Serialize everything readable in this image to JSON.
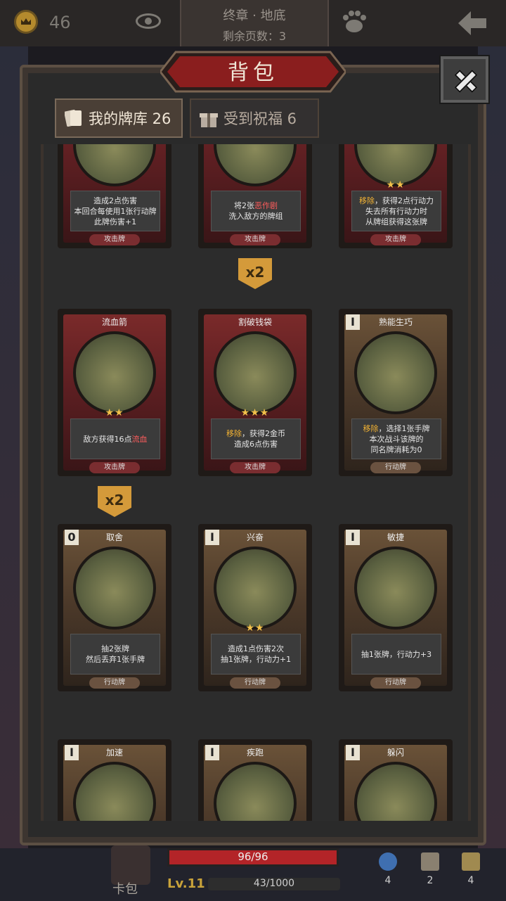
{
  "top_bar": {
    "gold": "46",
    "chapter": "终章 · 地底",
    "pages_left": "剩余页数：3",
    "icons": [
      "crown-coin-icon",
      "eye-icon",
      "paw-icon",
      "back-arrow-icon"
    ]
  },
  "panel": {
    "title": "背包",
    "tabs": [
      {
        "label": "我的牌库 26",
        "icon": "cards-icon",
        "active": true
      },
      {
        "label": "受到祝福 6",
        "icon": "gift-icon",
        "active": false
      }
    ]
  },
  "cards": [
    {
      "title": "",
      "cost": "",
      "desc_parts": [
        {
          "t": "造成2点伤害\n本回合每使用1张行动牌\n此牌伤害+1"
        }
      ],
      "stars": "",
      "type": "攻击牌",
      "kind": "attack"
    },
    {
      "title": "",
      "cost": "",
      "desc_parts": [
        {
          "t": "将2张"
        },
        {
          "t": "恶作剧",
          "c": "kw-red"
        },
        {
          "t": "\n洗入敌方的牌组"
        }
      ],
      "stars": "",
      "type": "攻击牌",
      "kind": "attack",
      "multiplier": "x2"
    },
    {
      "title": "",
      "cost": "",
      "desc_parts": [
        {
          "t": "移除",
          "c": "kw"
        },
        {
          "t": "，获得2点行动力\n失去所有行动力时\n从牌组获得这张牌"
        }
      ],
      "stars": "★★",
      "type": "攻击牌",
      "kind": "attack"
    },
    {
      "title": "流血箭",
      "cost": "",
      "desc_parts": [
        {
          "t": "敌方获得16点"
        },
        {
          "t": "流血",
          "c": "kw-red"
        }
      ],
      "stars": "★★",
      "type": "攻击牌",
      "kind": "attack",
      "multiplier": "x2"
    },
    {
      "title": "割破钱袋",
      "cost": "",
      "desc_parts": [
        {
          "t": "移除",
          "c": "kw"
        },
        {
          "t": "，获得2金币\n造成6点伤害"
        }
      ],
      "stars": "★★★",
      "type": "攻击牌",
      "kind": "attack"
    },
    {
      "title": "熟能生巧",
      "cost": "I",
      "desc_parts": [
        {
          "t": "移除",
          "c": "kw"
        },
        {
          "t": "，选择1张手牌\n本次战斗该牌的\n同名牌消耗为0"
        }
      ],
      "stars": "",
      "type": "行动牌",
      "kind": "skill"
    },
    {
      "title": "取舍",
      "cost": "0",
      "desc_parts": [
        {
          "t": "抽2张牌\n然后丢弃1张手牌"
        }
      ],
      "stars": "",
      "type": "行动牌",
      "kind": "skill"
    },
    {
      "title": "兴奋",
      "cost": "I",
      "desc_parts": [
        {
          "t": "造成1点伤害2次\n抽1张牌，行动力+1"
        }
      ],
      "stars": "★★",
      "type": "行动牌",
      "kind": "skill"
    },
    {
      "title": "敏捷",
      "cost": "I",
      "desc_parts": [
        {
          "t": "抽1张牌，行动力+3"
        }
      ],
      "stars": "",
      "type": "行动牌",
      "kind": "skill"
    },
    {
      "title": "加速",
      "cost": "I",
      "desc_parts": [],
      "stars": "",
      "type": "",
      "kind": "skill"
    },
    {
      "title": "疾跑",
      "cost": "I",
      "desc_parts": [],
      "stars": "",
      "type": "",
      "kind": "skill"
    },
    {
      "title": "躲闪",
      "cost": "I",
      "desc_parts": [],
      "stars": "",
      "type": "",
      "kind": "skill"
    }
  ],
  "bottom": {
    "deck_label": "卡包",
    "hp": "96/96",
    "hp_fraction": 1.0,
    "level": "Lv.11",
    "xp": "43/1000",
    "xp_fraction": 0.043,
    "inventory": [
      {
        "icon": "potion-icon",
        "count": "4"
      },
      {
        "icon": "hourglass-icon",
        "count": "2"
      },
      {
        "icon": "card-stack-icon",
        "count": "4"
      }
    ]
  }
}
